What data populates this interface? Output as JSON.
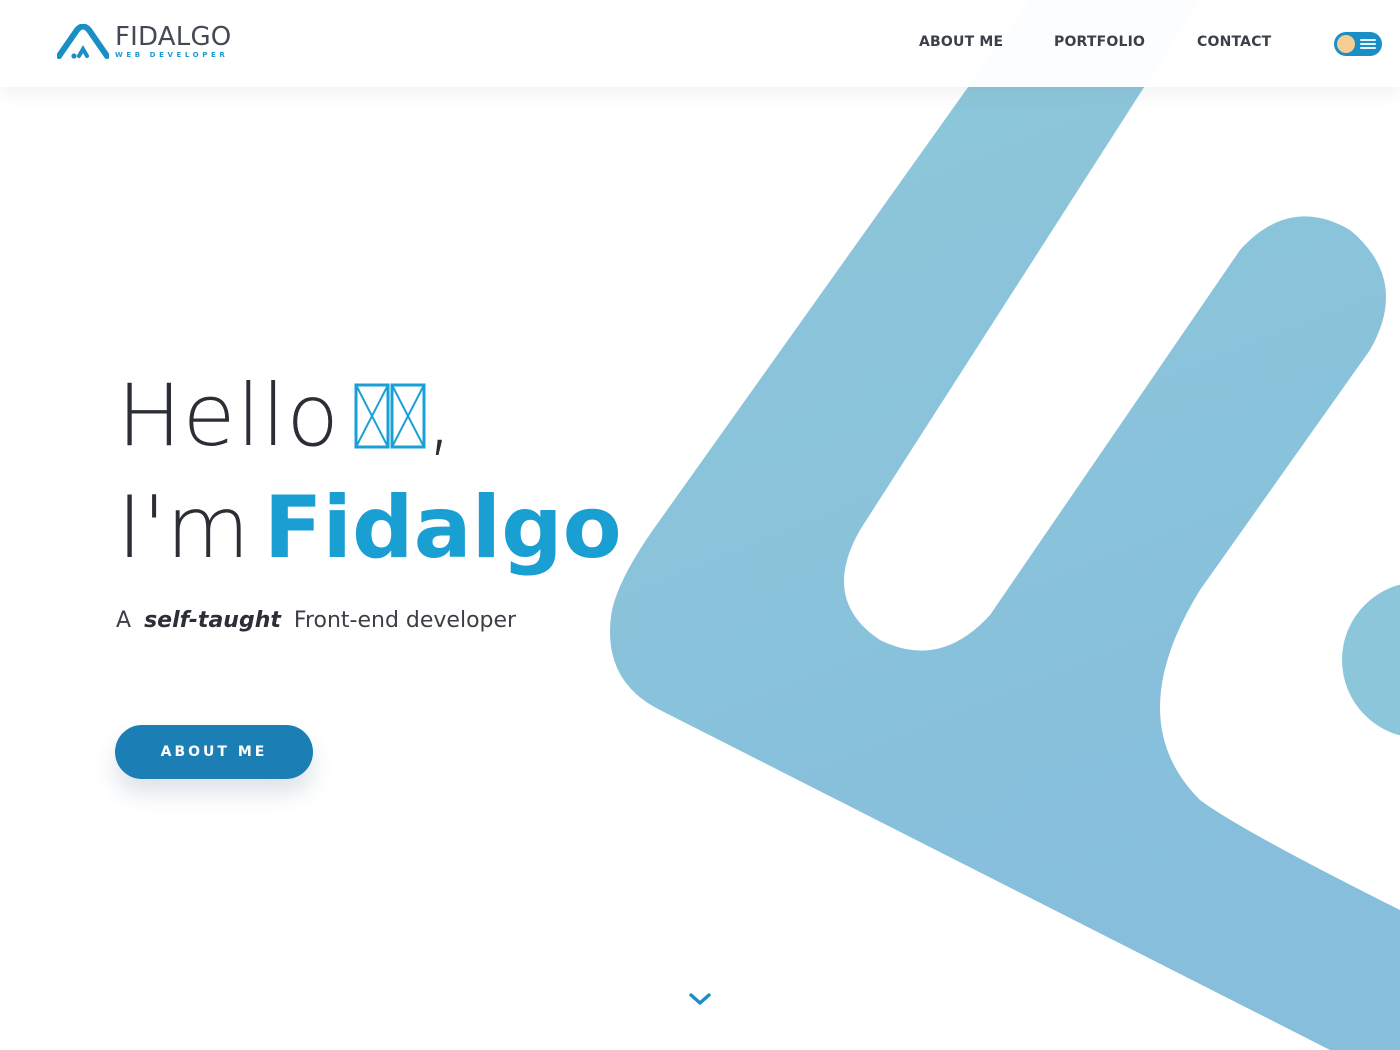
{
  "brand": {
    "name": "FIDALGO",
    "tagline": "WEB DEVELOPER",
    "logo_icon": "house-arch-logo-icon",
    "accent_color": "#1a9fd3"
  },
  "nav": {
    "items": [
      {
        "label": "ABOUT ME"
      },
      {
        "label": "PORTFOLIO"
      },
      {
        "label": "CONTACT"
      }
    ],
    "theme_toggle": {
      "icon": "theme-toggle-icon",
      "state": "light"
    }
  },
  "hero": {
    "greeting": "Hello",
    "greeting_emoji": "waving-hands-icon",
    "greeting_suffix": ",",
    "intro_prefix": "I'm",
    "name": "Fidalgo",
    "tagline_prefix": "A",
    "tagline_emphasis": "self-taught",
    "tagline_suffix": "Front-end developer",
    "cta_label": "ABOUT ME"
  },
  "scroll": {
    "icon": "chevron-down-icon"
  },
  "colors": {
    "shape": "#8cc6da",
    "button": "#1b7fb5",
    "text": "#2b2e35",
    "toggle": "#1a8fc5",
    "toggle_knob": "#f5cd95"
  }
}
